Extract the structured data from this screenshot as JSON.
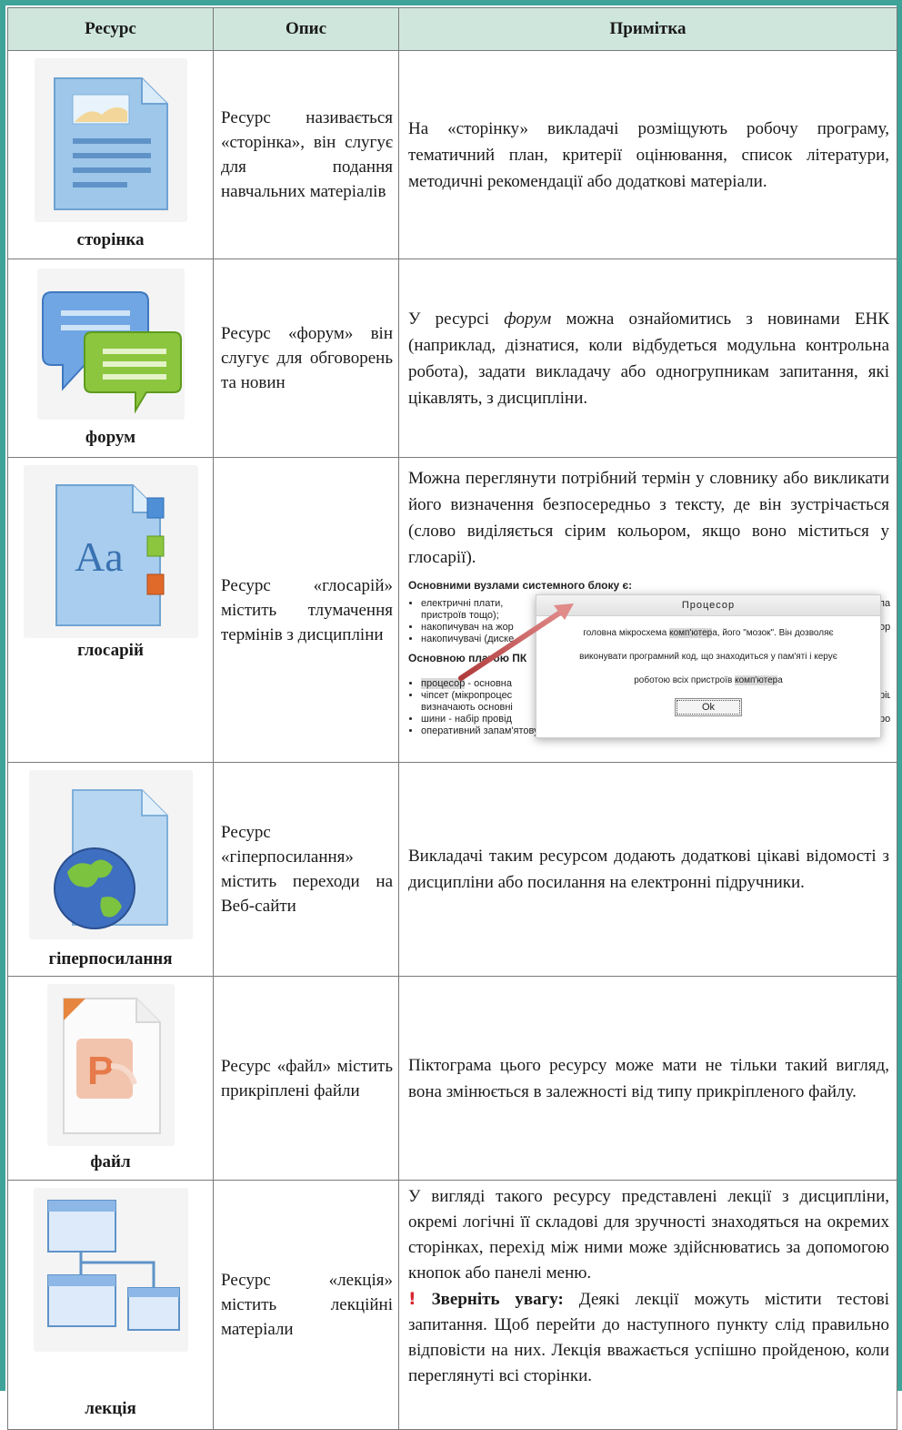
{
  "header": {
    "col1": "Ресурс",
    "col2": "Опис",
    "col3": "Примітка"
  },
  "rows": [
    {
      "icon_name": "page-icon",
      "label": "сторінка",
      "description": "Ресурс називається «сторінка», він слугує для подання навчальних матеріалів",
      "note": "На «сторінку» викладачі розміщують робочу програму, тематичний план, критерії оцінювання, список літератури, методичні рекомендації або додаткові матеріали."
    },
    {
      "icon_name": "forum-icon",
      "label": "форум",
      "description": "Ресурс «форум» він слугує для обговорень та новин",
      "note_parts": {
        "before": "У ресурсі ",
        "emph": "форум",
        "after": " можна ознайомитись з новинами ЕНК (наприклад, дізнатися, коли відбудеться модульна контрольна робота), задати викладачу або одногрупникам запитання, які цікавлять, з дисципліни."
      }
    },
    {
      "icon_name": "glossary-icon",
      "label": "глосарій",
      "description": "Ресурс «глосарій» містить тлумачення термінів з дисципліни",
      "note": "Можна переглянути потрібний термін у словнику або викликати його визначення безпосередньо з тексту, де він зустрічається (слово виділяється сірим кольором, якщо воно міститься у глосарії).",
      "screenshot": {
        "heading1": "Основними вузлами системного блоку є:",
        "list1": [
          "електричні плати,",
          "пристроїв тощо);",
          "накопичувач на жор",
          "накопичувачі (диске"
        ],
        "heading2": "Основною платою ПК",
        "list2_hl": "процесор",
        "list2_first_rest": " - основна",
        "list2": [
          "чіпсет (мікропроцес",
          "визначають основні",
          "шини - набір провід",
          "оперативний запам'ятовуючий пристрій (ОЗП) - набір мікросхем, що призначені для тимч"
        ],
        "right_fragments": [
          "па",
          "орм",
          "ріш",
          "роз"
        ],
        "dialog": {
          "title": "Процесор",
          "line1_before": "головна мікросхема ",
          "term": "комп'ютер",
          "line1_after": "а, його \"мозок\". Він дозволяє",
          "line2": "виконувати програмний код, що знаходиться у пам'яті і керує",
          "line3_before": "роботою всіх пристроїв ",
          "line3_after": "а",
          "ok": "Ok"
        }
      }
    },
    {
      "icon_name": "hyperlink-icon",
      "label": "гіперпосилання",
      "description": "Ресурс «гіперпосилання» містить переходи на Веб-сайти",
      "note": "Викладачі таким ресурсом додають додаткові цікаві відомості з дисципліни або посилання на електронні підручники."
    },
    {
      "icon_name": "file-icon",
      "label": "файл",
      "description": "Ресурс «файл» містить прикріплені файли",
      "note": "Піктограма цього ресурсу може мати не тільки такий вигляд, вона змінюється в залежності від типу прикріпленого файлу."
    },
    {
      "icon_name": "lesson-icon",
      "label": "лекція",
      "description": "Ресурс «лекція» містить лекційні матеріали",
      "note": "У вигляді такого ресурсу представлені лекції з дисципліни, окремі логічні її складові для зручності знаходяться на окремих сторінках, перехід між ними може здійснюватись за допомогою кнопок або панелі меню.",
      "warning_mark": "!",
      "warning_title": "Зверніть увагу:",
      "warning_text": " Деякі лекції можуть містити тестові запитання. Щоб перейти до наступного пункту слід правильно відповісти на них. Лекція вважається успішно пройденою, коли переглянуті всі сторінки."
    }
  ],
  "colors": {
    "frame": "#3fa39a",
    "header_bg": "#cfe6dd",
    "warning": "#d9262f"
  }
}
